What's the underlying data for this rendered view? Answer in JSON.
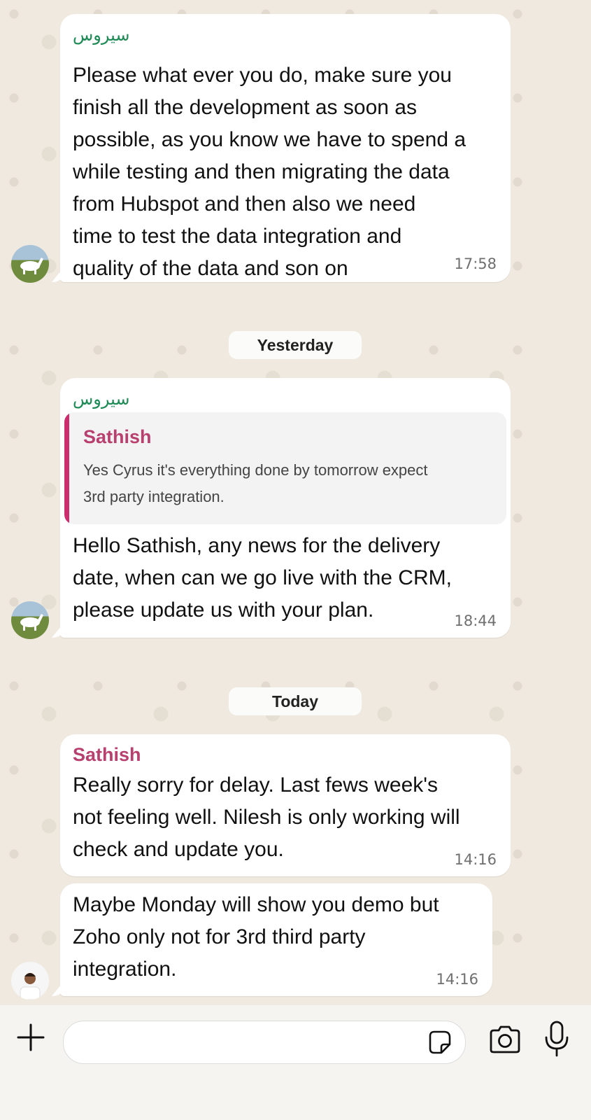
{
  "messages": [
    {
      "sender": "سیروس",
      "text": "Please what ever you do, make sure you\nfinish all the development as soon as\npossible, as you know we have to spend a\nwhile testing and then migrating the data\nfrom Hubspot and then also we need\ntime to test the data integration and\nquality of the data and son on",
      "time": "17:58"
    },
    {
      "sender": "سیروس",
      "quote_sender": "Sathish",
      "quote_text": "Yes Cyrus it's everything done by tomorrow expect\n3rd party integration.",
      "text": "Hello Sathish, any news for the delivery\ndate, when can we go live with the CRM,\nplease update us with your plan.",
      "time": "18:44"
    },
    {
      "sender": "Sathish",
      "text": "Really sorry for delay. Last fews week's\nnot feeling well. Nilesh is only working will\ncheck and update you.",
      "time": "14:16"
    },
    {
      "text": "Maybe Monday will show you demo but\nZoho only not for 3rd third party\nintegration.",
      "time": "14:16"
    }
  ],
  "day_separators": {
    "yesterday": "Yesterday",
    "today": "Today"
  },
  "composer": {
    "input_value": "",
    "icons": [
      "plus-icon",
      "sticker-icon",
      "camera-icon",
      "microphone-icon"
    ]
  },
  "colors": {
    "background": "#efe9df",
    "bubble": "#ffffff",
    "sender_green": "#1e8a55",
    "sender_pink": "#b8406f",
    "quote_bar": "#cc2d6c"
  }
}
